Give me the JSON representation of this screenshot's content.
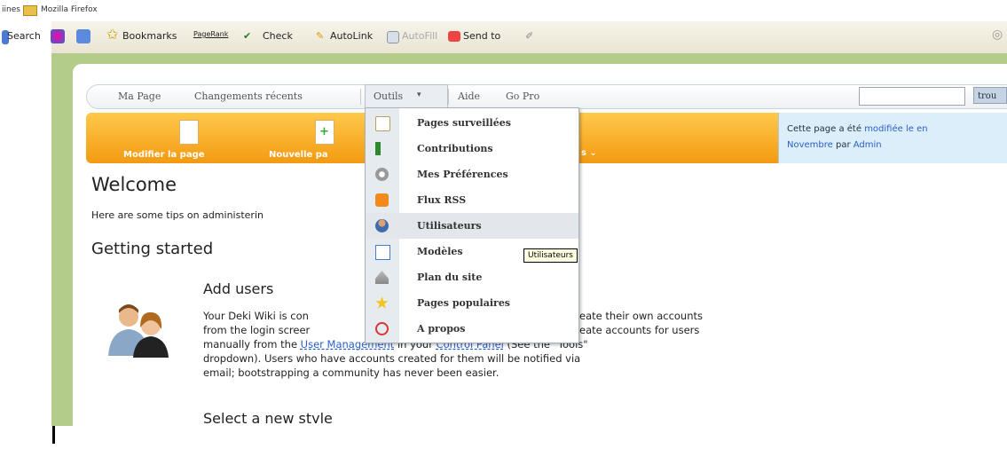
{
  "window": {
    "title_left": "iines",
    "title": "Mozilla Firefox"
  },
  "toolbar": {
    "search": "Search",
    "bookmarks": "Bookmarks",
    "pagerank": "PageRank",
    "check": "Check",
    "autolink": "AutoLink",
    "autofill": "AutoFill",
    "sendto": "Send to"
  },
  "nav": {
    "ma_page": "Ma Page",
    "changements": "Changements récents",
    "outils": "Outils",
    "aide": "Aide",
    "gopro": "Go Pro",
    "search_button": "trou"
  },
  "actions": {
    "modifier": "Modifier la page",
    "nouvelle": "Nouvelle pa"
  },
  "notice": {
    "line1_a": "Cette page a été ",
    "line1_link": "modifiée le en",
    "line2_a": "Novembre",
    "line2_b": " par ",
    "line2_link": "Admin"
  },
  "content": {
    "welcome": "Welcome",
    "tips": "Here are some tips on administerin",
    "getting_started": "Getting started",
    "add_users": "Add users",
    "p1": "Your Deki Wiki is con",
    "p1b": "eate their own accounts",
    "p2": "from the login screer",
    "p2b": "eate accounts for users",
    "p3a": "manually from the ",
    "p3link1": "User Management",
    "p3b": " in your ",
    "p3link2": "Control Panel",
    "p3c": " (See the \"Tools\"",
    "p4": "dropdown). Users who have accounts created for them will be notified via",
    "p5": "email; bootstrapping a community has never been easier.",
    "select_style": "Select a new style"
  },
  "dropdown": {
    "items": [
      {
        "label": "Pages surveillées",
        "icon": "watch-page-icon"
      },
      {
        "label": "Contributions",
        "icon": "flag-icon"
      },
      {
        "label": "Mes Préférences",
        "icon": "gear-icon"
      },
      {
        "label": "Flux RSS",
        "icon": "rss-icon"
      },
      {
        "label": "Utilisateurs",
        "icon": "user-icon"
      },
      {
        "label": "Modèles",
        "icon": "template-icon"
      },
      {
        "label": "Plan du site",
        "icon": "sitemap-icon"
      },
      {
        "label": "Pages populaires",
        "icon": "star-icon"
      },
      {
        "label": "A propos",
        "icon": "help-icon"
      }
    ],
    "highlighted": "Utilisateurs"
  },
  "tooltip": "Utilisateurs"
}
